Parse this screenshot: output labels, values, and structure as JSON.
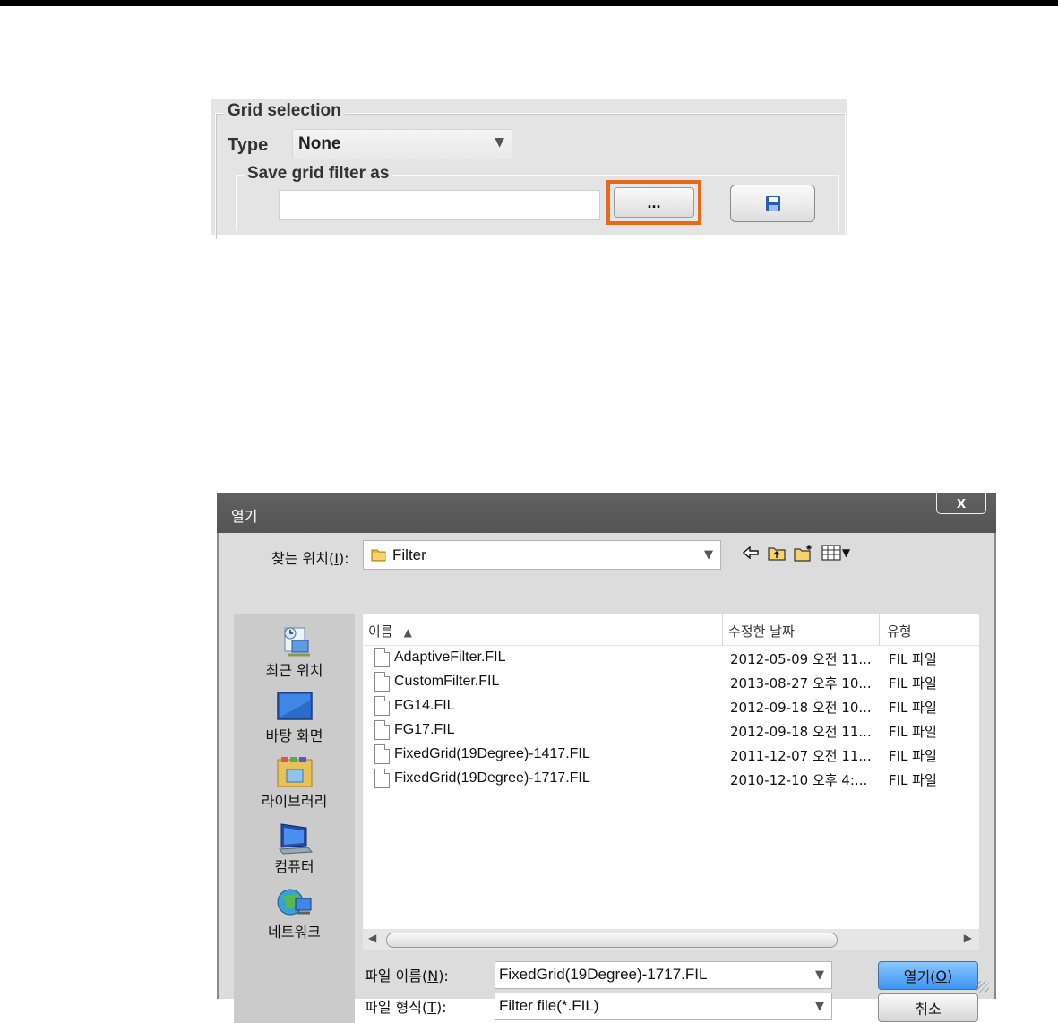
{
  "grid_panel": {
    "legend": "Grid selection",
    "type_label": "Type",
    "type_value": "None",
    "save_legend": "Save grid filter as",
    "save_input_value": "",
    "browse_label": "...",
    "save_icon": "floppy-disk-icon",
    "highlight_color": "#e8681c"
  },
  "dialog": {
    "title": "열기",
    "close_label": "x",
    "lookin_label_prefix": "찾는 위치(",
    "lookin_label_key": "I",
    "lookin_label_suffix": "):",
    "lookin_value": "Filter",
    "places": [
      {
        "label": "최근 위치",
        "icon": "recent-places-icon"
      },
      {
        "label": "바탕 화면",
        "icon": "desktop-icon"
      },
      {
        "label": "라이브러리",
        "icon": "libraries-icon"
      },
      {
        "label": "컴퓨터",
        "icon": "computer-icon"
      },
      {
        "label": "네트워크",
        "icon": "network-icon"
      }
    ],
    "columns": {
      "name": "이름",
      "date": "수정한 날짜",
      "type": "유형"
    },
    "files": [
      {
        "name": "AdaptiveFilter.FIL",
        "date": "2012-05-09 오전 11...",
        "type": "FIL 파일"
      },
      {
        "name": "CustomFilter.FIL",
        "date": "2013-08-27 오후 10...",
        "type": "FIL 파일"
      },
      {
        "name": "FG14.FIL",
        "date": "2012-09-18 오전 10...",
        "type": "FIL 파일"
      },
      {
        "name": "FG17.FIL",
        "date": "2012-09-18 오전 11...",
        "type": "FIL 파일"
      },
      {
        "name": "FixedGrid(19Degree)-1417.FIL",
        "date": "2011-12-07 오전 11...",
        "type": "FIL 파일"
      },
      {
        "name": "FixedGrid(19Degree)-1717.FIL",
        "date": "2010-12-10 오후 4:...",
        "type": "FIL 파일"
      }
    ],
    "filename_label_prefix": "파일 이름(",
    "filename_label_key": "N",
    "filename_label_suffix": "):",
    "filename_value": "FixedGrid(19Degree)-1717.FIL",
    "filetype_label_prefix": "파일 형식(",
    "filetype_label_key": "T",
    "filetype_label_suffix": "):",
    "filetype_value": "Filter file(*.FIL)",
    "open_label_prefix": "열기(",
    "open_label_key": "O",
    "open_label_suffix": ")",
    "cancel_label": "취소",
    "accent_color": "#3b95f0"
  }
}
